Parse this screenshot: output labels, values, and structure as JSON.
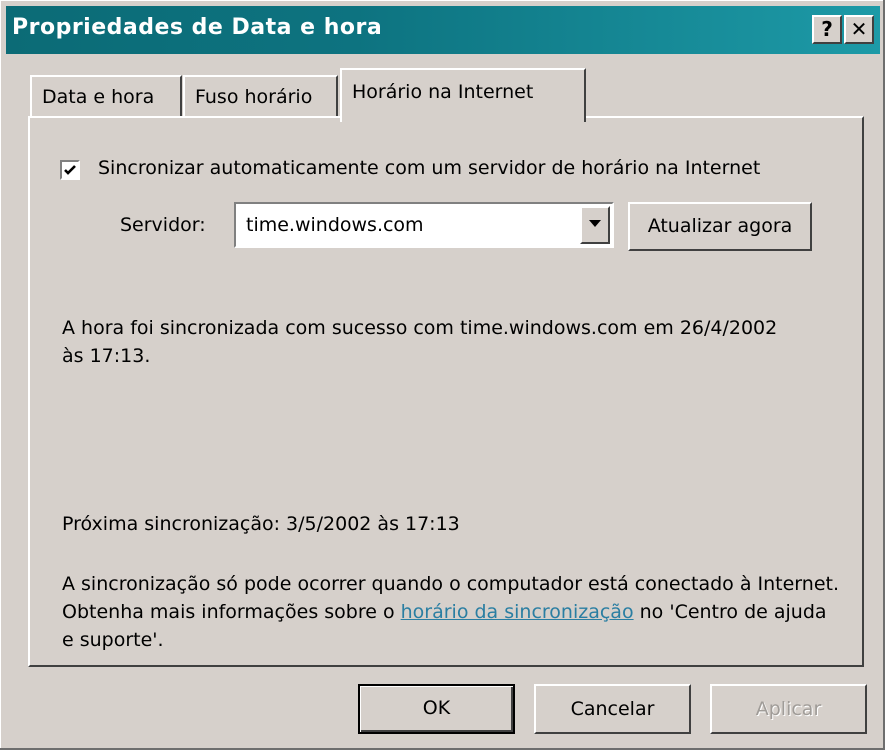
{
  "window": {
    "title": "Propriedades de Data e hora",
    "help_label": "?",
    "close_label": "✕"
  },
  "tabs": [
    {
      "label": "Data e hora",
      "active": false
    },
    {
      "label": "Fuso horário",
      "active": false
    },
    {
      "label": "Horário na Internet",
      "active": true
    }
  ],
  "sync": {
    "checkbox_checked": true,
    "checkbox_label": "Sincronizar automaticamente com um servidor de horário na Internet",
    "server_label": "Servidor:",
    "server_value": "time.windows.com",
    "update_button": "Atualizar agora",
    "success_text": "A hora foi sincronizada com sucesso com time.windows.com em 26/4/2002 às 17:13.",
    "next_sync_text": "Próxima sincronização: 3/5/2002 às 17:13",
    "note_before_link": "A sincronização só pode ocorrer quando o computador está conectado à Internet. Obtenha mais informações sobre o ",
    "note_link": "horário da sincronização",
    "note_after_link": " no 'Centro de ajuda e suporte'."
  },
  "buttons": {
    "ok": "OK",
    "cancel": "Cancelar",
    "apply": "Aplicar"
  },
  "colors": {
    "titlebar": "#0c6b76",
    "face": "#d6d0cb",
    "link": "#2a7ea2"
  }
}
